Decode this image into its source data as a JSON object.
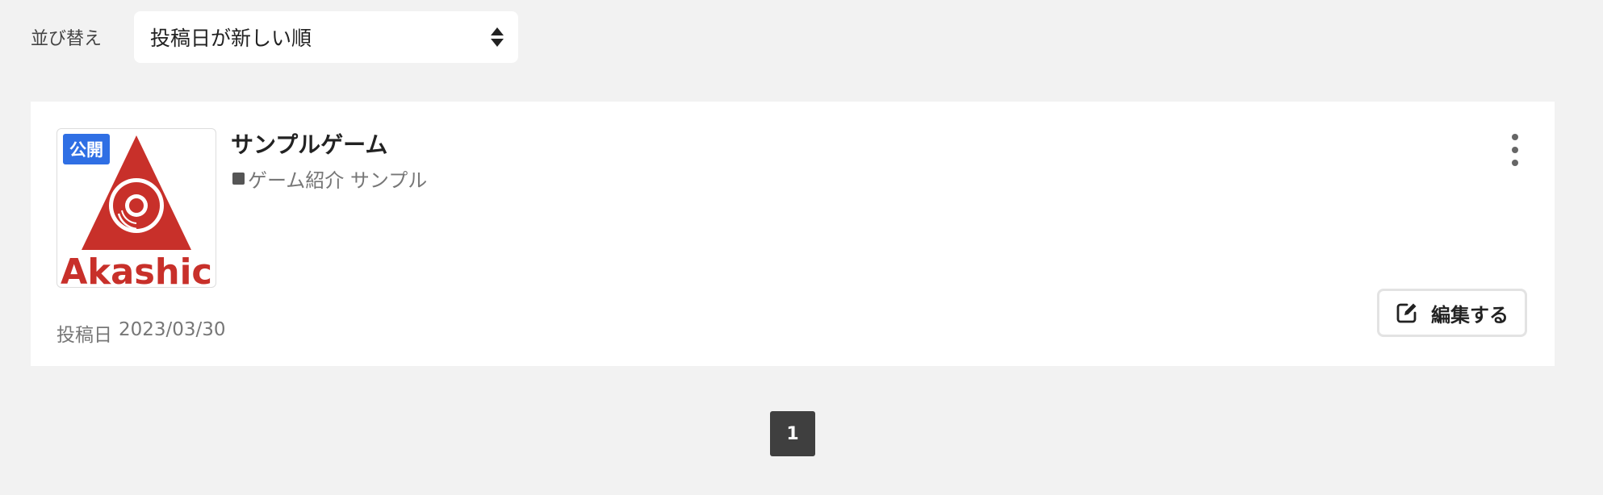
{
  "sort": {
    "label": "並び替え",
    "selected": "投稿日が新しい順"
  },
  "post": {
    "status_badge": "公開",
    "thumbnail_logo": "Akashic",
    "title": "サンプルゲーム",
    "tags_text": "ゲーム紹介 サンプル",
    "date_label": "投稿日",
    "date_value": "2023/03/30",
    "edit_label": "編集する",
    "more_icon": "vertical-ellipsis-icon",
    "edit_icon": "edit-square-pencil-icon"
  },
  "pagination": {
    "current_page": "1"
  },
  "colors": {
    "background": "#f2f2f2",
    "badge": "#2f6fe4",
    "logo_red": "#c8302a",
    "pager": "#3f3f3f"
  }
}
